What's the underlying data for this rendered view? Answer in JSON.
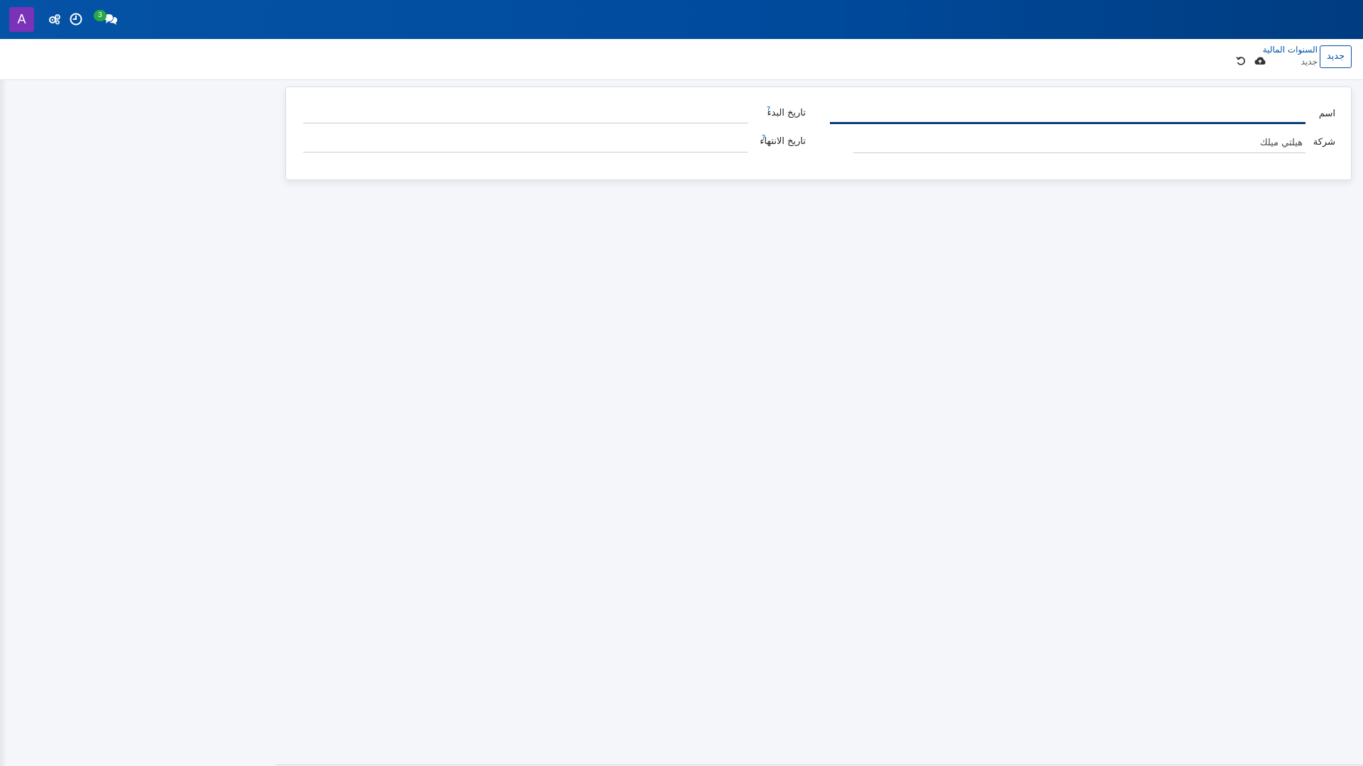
{
  "navbar": {
    "avatar_letter": "A",
    "avatar_color": "#7a32b8",
    "bar_color": "#0553a6",
    "icons": [
      "settings-gears-icon",
      "clock-icon",
      "chat-icon"
    ],
    "chat_badge_count": "3",
    "badge_color": "#28a745"
  },
  "control_panel": {
    "new_button_label": "جديد",
    "breadcrumb_parent": "السنوات المالية",
    "breadcrumb_current": "جديد",
    "icons": [
      "save-cloud-icon",
      "discard-undo-icon"
    ]
  },
  "form": {
    "name_label": "اسم",
    "name_value": "",
    "company_label": "شركة",
    "company_value": "هيلتي ميلك",
    "start_date_label": "تاريخ البدء",
    "start_date_value": "",
    "end_date_label": "تاريخ الانتهاء",
    "end_date_value": "",
    "help_mark": "?"
  }
}
